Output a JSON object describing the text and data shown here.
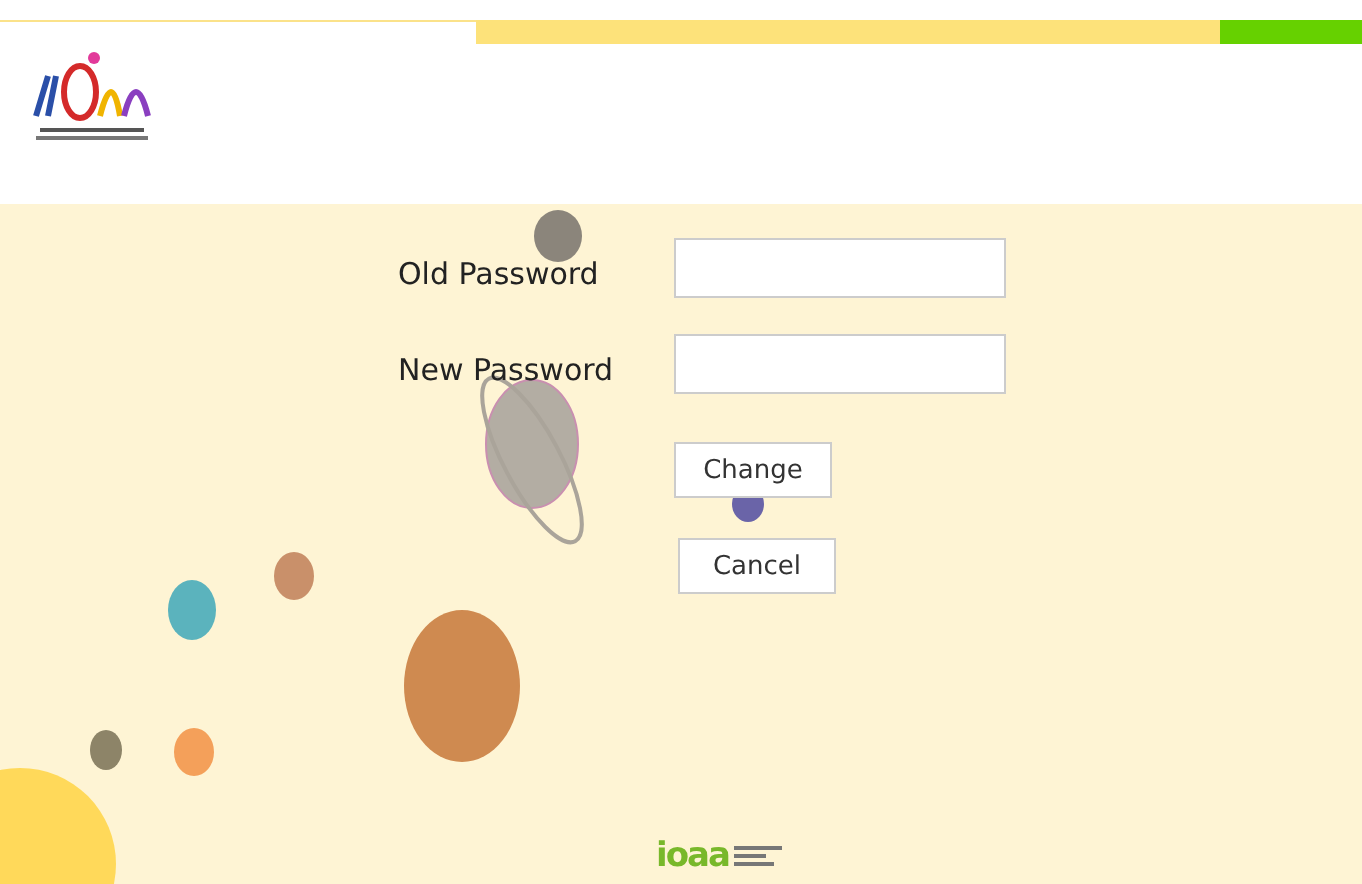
{
  "form": {
    "fields": [
      {
        "label": "Old Password"
      },
      {
        "label": "New Password"
      }
    ],
    "buttons": [
      "Change",
      "Cancel"
    ]
  },
  "footer": {
    "logo_text": "ioaa"
  }
}
